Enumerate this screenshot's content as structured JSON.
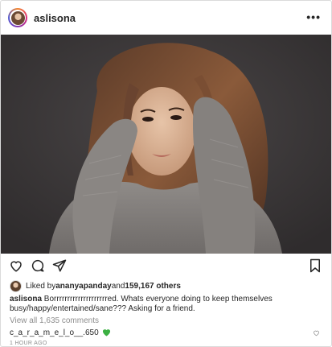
{
  "post": {
    "username": "aslisona",
    "more_label": "•••",
    "photo_icon": "portrait-photo"
  },
  "actions": {
    "like_icon": "heart-outline-icon",
    "comment_icon": "comment-bubble-icon",
    "share_icon": "paper-plane-icon",
    "save_icon": "bookmark-icon"
  },
  "likes": {
    "prefix": "Liked by ",
    "user": "ananyapanday",
    "middle": " and ",
    "count": "159,167 others"
  },
  "caption": {
    "username": "aslisona",
    "text": " Borrrrrrrrrrrrrrrrrrrred. Whats everyone doing to keep themselves busy/happy/entertained/sane??? Asking for a friend."
  },
  "comments": {
    "view_all": "View all 1,635 comments",
    "items": [
      {
        "username": "c_a_r_a_m_e_l_o__.650",
        "emoji": "green-heart",
        "emoji_color": "#3cb043"
      }
    ]
  },
  "timestamp": "1 HOUR AGO",
  "colors": {
    "text": "#262626",
    "muted": "#8e8e8e",
    "border": "#dbdbdb"
  }
}
